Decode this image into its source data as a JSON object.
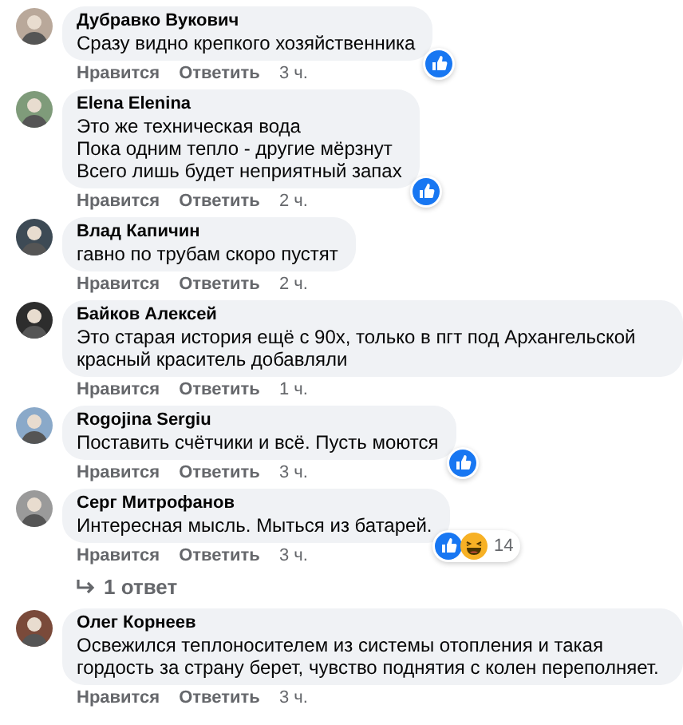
{
  "comments": [
    {
      "author": "Дубравко Вукович",
      "lines": [
        "Сразу видно крепкого хозяйственника"
      ],
      "like": "Нравится",
      "reply": "Ответить",
      "time": "3 ч.",
      "reactions": [
        {
          "kind": "like"
        }
      ]
    },
    {
      "author": "Elena Elenina",
      "lines": [
        "Это же техническая вода",
        "Пока одним тепло - другие мёрзнут",
        "Всего лишь будет неприятный запах"
      ],
      "like": "Нравится",
      "reply": "Ответить",
      "time": "2 ч.",
      "reactions": [
        {
          "kind": "like"
        }
      ]
    },
    {
      "author": "Влад Капичин",
      "lines": [
        "гавно по трубам скоро пустят"
      ],
      "like": "Нравится",
      "reply": "Ответить",
      "time": "2 ч."
    },
    {
      "author": "Байков Алексей",
      "lines": [
        "Это старая история ещё с 90х, только в пгт под Архангельской красный краситель добавляли"
      ],
      "like": "Нравится",
      "reply": "Ответить",
      "time": "1 ч."
    },
    {
      "author": "Rogojina Sergiu",
      "lines": [
        "Поставить счётчики и всё. Пусть моются"
      ],
      "like": "Нравится",
      "reply": "Ответить",
      "time": "3 ч.",
      "reactions": [
        {
          "kind": "like"
        }
      ]
    },
    {
      "author": "Серг Митрофанов",
      "lines": [
        "Интересная мысль. Мыться из батарей."
      ],
      "like": "Нравится",
      "reply": "Ответить",
      "time": "3 ч.",
      "reactions": [
        {
          "kind": "like"
        },
        {
          "kind": "haha"
        }
      ],
      "reaction_count": "14",
      "replies_link": "1 ответ"
    },
    {
      "author": "Олег Корнеев",
      "lines": [
        "Освежился теплоносителем из системы отопления и такая гордость за страну берет, чувство поднятия с колен переполняет."
      ],
      "like": "Нравится",
      "reply": "Ответить",
      "time": "3 ч."
    }
  ]
}
